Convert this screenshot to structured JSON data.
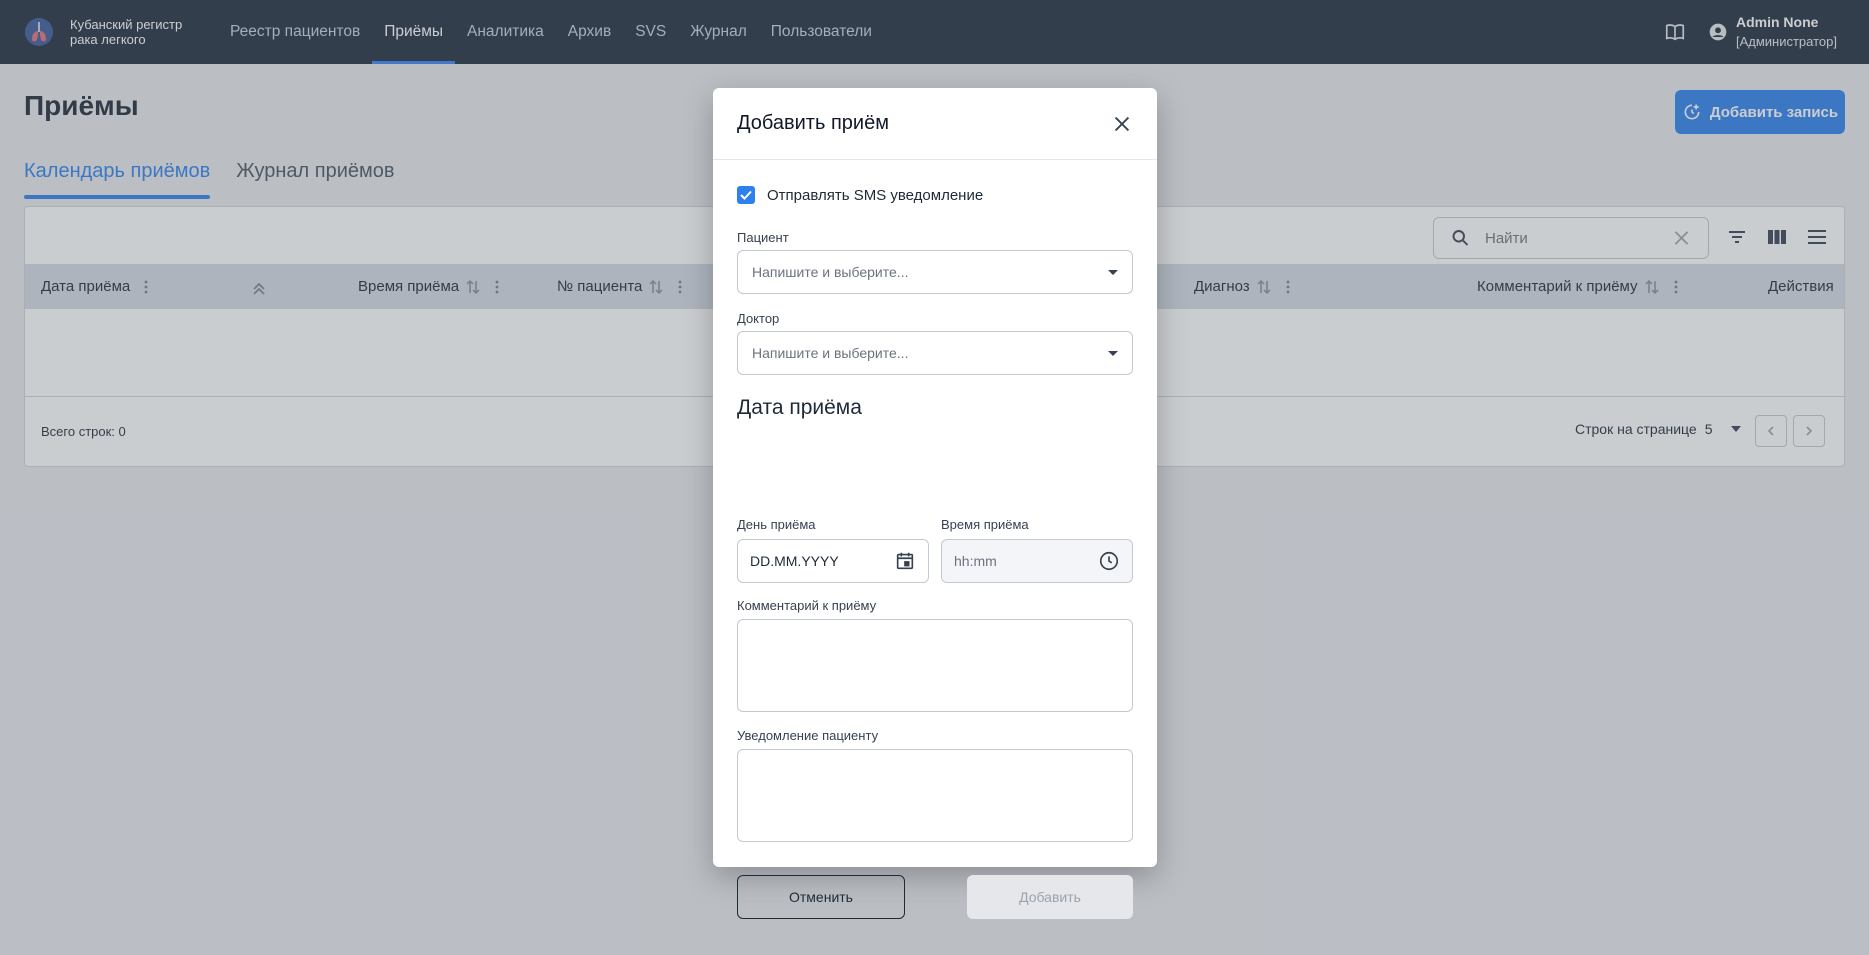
{
  "app": {
    "brand_line1": "Кубанский регистр",
    "brand_line2": "рака легкого"
  },
  "nav": {
    "items": [
      {
        "label": "Реестр пациентов",
        "active": false
      },
      {
        "label": "Приёмы",
        "active": true
      },
      {
        "label": "Аналитика",
        "active": false
      },
      {
        "label": "Архив",
        "active": false
      },
      {
        "label": "SVS",
        "active": false
      },
      {
        "label": "Журнал",
        "active": false
      },
      {
        "label": "Пользователи",
        "active": false
      }
    ]
  },
  "user": {
    "name": "Admin None",
    "role": "[Администратор]"
  },
  "page": {
    "title": "Приёмы",
    "add_record_label": "Добавить запись",
    "tabs": [
      {
        "label": "Календарь приёмов",
        "active": true
      },
      {
        "label": "Журнал приёмов",
        "active": false
      }
    ]
  },
  "table": {
    "search_placeholder": "Найти",
    "columns": [
      "Дата приёма",
      "Время приёма",
      "№ пациента",
      "Диагноз",
      "Комментарий к приёму",
      "Действия"
    ],
    "total_rows": "Всего строк: 0",
    "rows_per_page_label": "Строк на странице",
    "rows_per_page_value": "5"
  },
  "modal": {
    "title": "Добавить приём",
    "sms_label": "Отправлять SMS уведомление",
    "sms_checked": true,
    "patient_label": "Пациент",
    "patient_placeholder": "Напишите и выберите...",
    "doctor_label": "Доктор",
    "doctor_placeholder": "Напишите и выберите...",
    "section_title": "Дата приёма",
    "day_label": "День приёма",
    "day_value": "DD.MM.YYYY",
    "time_label": "Время приёма",
    "time_placeholder": "hh:mm",
    "comment_label": "Комментарий к приёму",
    "notify_label": "Уведомление пациенту",
    "cancel_label": "Отменить",
    "add_label": "Добавить"
  },
  "colors": {
    "topbar": "#1f2d3d",
    "accent": "#2f80ed",
    "header_row": "#d5dbe3"
  }
}
